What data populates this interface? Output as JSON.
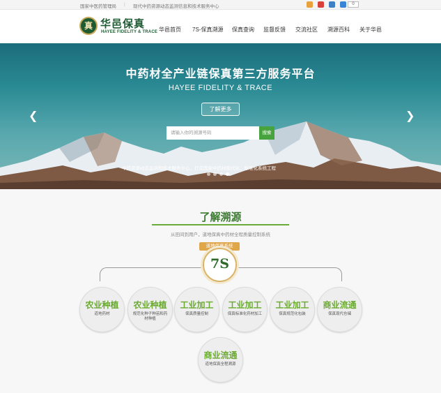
{
  "topbar": {
    "left_text": "国家中医药管理局",
    "right_text": "现代中药资源动态监测信息和技术服务中心",
    "counter": "0",
    "icons": [
      "home-icon",
      "weibo-icon",
      "mail-icon",
      "qq-icon"
    ]
  },
  "header": {
    "logo_text": "真",
    "brand_cn": "华邑保真",
    "brand_en": "HAYEE FIDELITY & TRACE"
  },
  "nav": [
    {
      "label": "华邑首页"
    },
    {
      "label": "7S-保真溯源"
    },
    {
      "label": "保真查询"
    },
    {
      "label": "监督反馈"
    },
    {
      "label": "交流社区"
    },
    {
      "label": "溯源百科"
    },
    {
      "label": "关于华邑"
    }
  ],
  "hero": {
    "title": "中药材全产业链保真第三方服务平台",
    "subtitle": "HAYEE FIDELITY & TRACE",
    "more_button": "了解更多",
    "search_placeholder": "请输入你的溯源号码",
    "search_button": "搜索",
    "caption": "中药资源动态监测和技术服务中心，打造国家中药材现代化、标准化系统工程",
    "slides": 4,
    "active_slide": 4
  },
  "trace": {
    "title": "了解溯源",
    "subtitle": "从田间到用户，道地保真中药材全程质量控制系统",
    "badge": "道地保真系统",
    "emblem": "7S",
    "items": [
      {
        "title": "农业种植",
        "desc": "道地药材"
      },
      {
        "title": "农业种植",
        "desc": "规范化种子种苗和药材种植"
      },
      {
        "title": "工业加工",
        "desc": "保真质量控制"
      },
      {
        "title": "工业加工",
        "desc": "保真标准化药材加工"
      },
      {
        "title": "工业加工",
        "desc": "保真规范化包装"
      },
      {
        "title": "商业流通",
        "desc": "保真现代仓储"
      },
      {
        "title": "商业流通",
        "desc": "道地保真全程溯源"
      }
    ]
  },
  "colors": {
    "brand_green": "#1e5b33",
    "accent_green": "#6aaa2f",
    "search_green": "#47a33e",
    "badge_gold": "#e0a64a"
  }
}
